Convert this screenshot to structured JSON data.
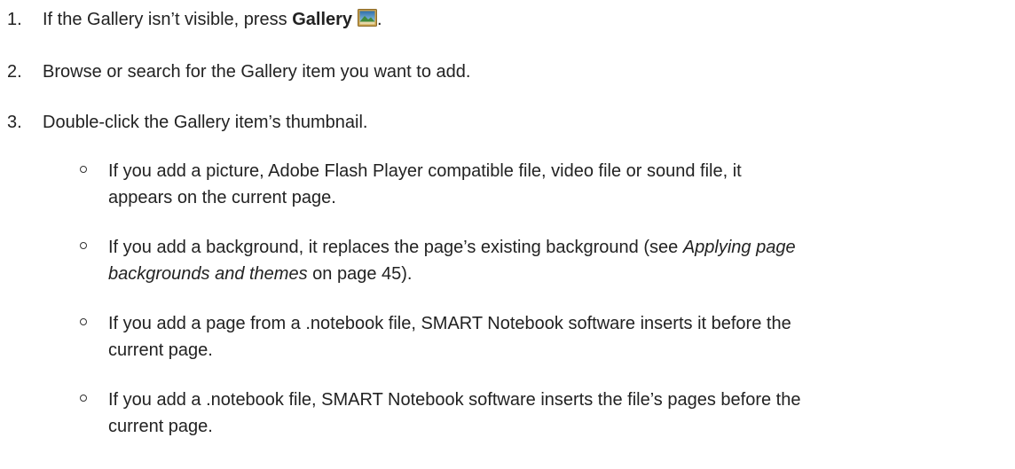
{
  "steps": [
    {
      "number": "1.",
      "prefix": "If the Gallery isn’t visible, press ",
      "bold": "Gallery",
      "icon": "gallery-icon",
      "suffix": "."
    },
    {
      "number": "2.",
      "text": "Browse or search for the Gallery item you want to add."
    },
    {
      "number": "3.",
      "text": "Double-click the Gallery item’s thumbnail."
    }
  ],
  "bullets": [
    {
      "line1": "If you add a picture, Adobe Flash Player compatible file, video file or sound file, it",
      "line2": "appears on the current page."
    },
    {
      "line1_prefix": "If you add a background, it replaces the page’s existing background (see ",
      "line1_italic": "Applying page",
      "line2_italic": "backgrounds and themes",
      "line2_suffix": " on page 45)."
    },
    {
      "line1": "If you add a page from a .notebook file, SMART Notebook software inserts it before the",
      "line2": "current page."
    },
    {
      "line1": "If you add a .notebook file, SMART Notebook software inserts the file’s pages before the",
      "line2": "current page."
    }
  ]
}
